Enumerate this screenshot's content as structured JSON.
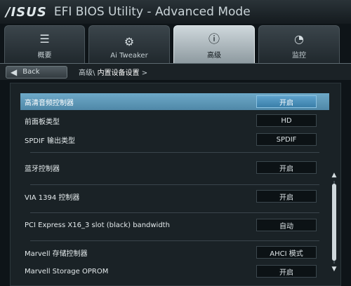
{
  "title": {
    "logo": "/ISUS",
    "text": "EFI BIOS Utility - Advanced Mode"
  },
  "tabs": [
    {
      "label": "概要",
      "icon": "list-icon"
    },
    {
      "label": "Ai Tweaker",
      "icon": "tweaker-icon"
    },
    {
      "label": "高级",
      "icon": "advanced-info-icon"
    },
    {
      "label": "监控",
      "icon": "monitor-gauge-icon"
    }
  ],
  "header": {
    "back_label": "Back",
    "breadcrumb_parent": "高级\\",
    "breadcrumb_current": "内置设备设置",
    "breadcrumb_arrow": ">"
  },
  "settings": [
    {
      "label": "高清音频控制器",
      "value": "开启"
    },
    {
      "label": "前面板类型",
      "value": "HD"
    },
    {
      "label": "SPDIF 输出类型",
      "value": "SPDIF"
    },
    {
      "label": "蓝牙控制器",
      "value": "开启"
    },
    {
      "label": "VIA 1394 控制器",
      "value": "开启"
    },
    {
      "label": "PCI Express X16_3 slot (black) bandwidth",
      "value": "自动"
    },
    {
      "label": "Marvell 存储控制器",
      "value": "AHCI 模式"
    },
    {
      "label": "Marvell Storage OPROM",
      "value": "开启"
    }
  ],
  "colors": {
    "accent": "#4f88a8",
    "background": "#0e1418"
  }
}
